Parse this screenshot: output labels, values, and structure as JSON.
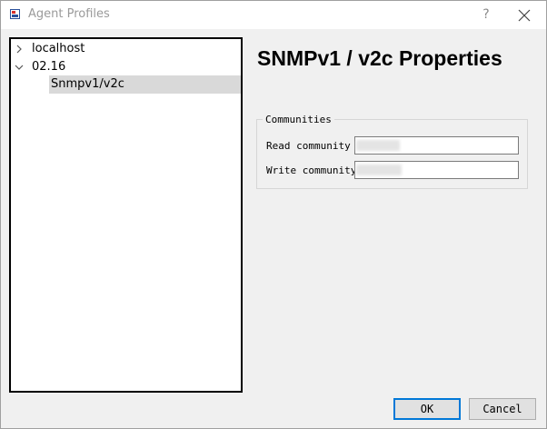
{
  "window": {
    "title": "Agent Profiles",
    "help_label": "?"
  },
  "tree": {
    "items": [
      {
        "label": "localhost",
        "expanded": false,
        "icon": "chevron-right-icon"
      },
      {
        "label": "02.16",
        "expanded": true,
        "icon": "chevron-down-icon",
        "children": [
          {
            "label": "Snmpv1/v2c",
            "selected": true
          }
        ]
      }
    ]
  },
  "properties": {
    "title": "SNMPv1 / v2c Properties",
    "group_label": "Communities",
    "read_label": "Read community",
    "write_label": "Write community",
    "read_value": "",
    "write_value": ""
  },
  "buttons": {
    "ok_label": "OK",
    "cancel_label": "Cancel"
  },
  "colors": {
    "selection": "#d9d9d9",
    "default_button_border": "#0078d7",
    "dialog_background": "#f0f0f0"
  }
}
